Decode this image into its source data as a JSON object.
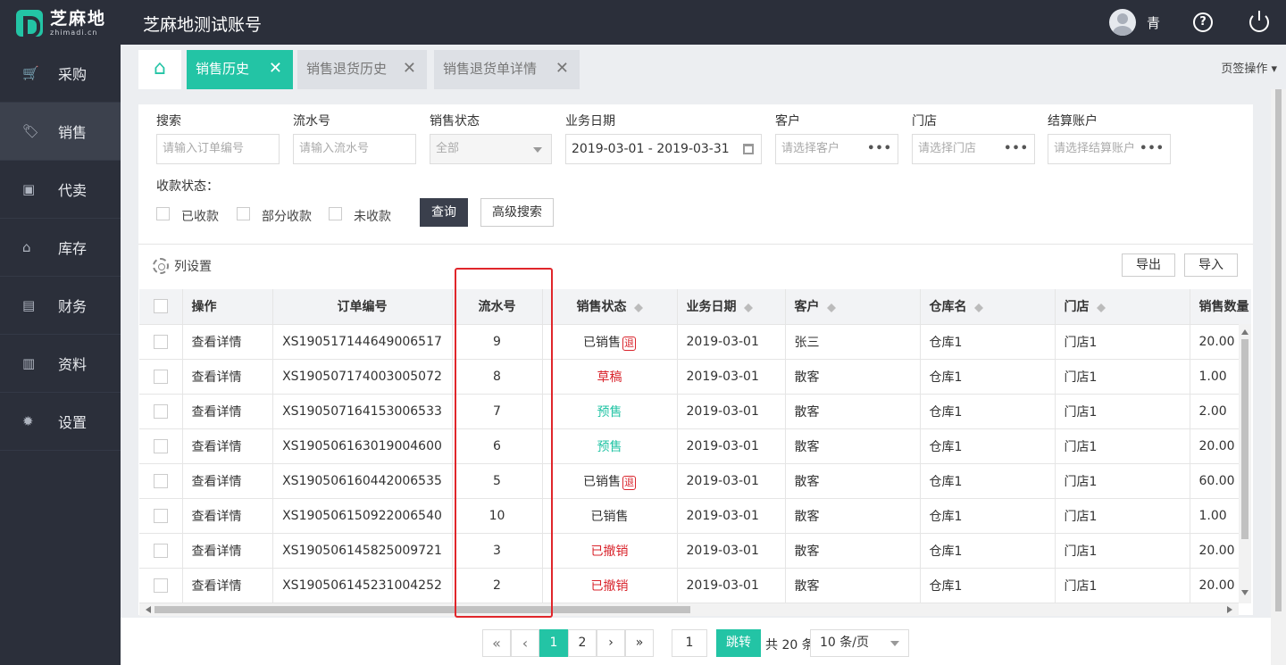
{
  "header": {
    "logo_cn": "芝麻地",
    "logo_en": "zhimadi.cn",
    "title": "芝麻地测试账号",
    "user_name": "青",
    "help_glyph": "?"
  },
  "sidebar": {
    "items": [
      {
        "label": "采购",
        "icon": "🛒"
      },
      {
        "label": "销售",
        "icon": "🏷"
      },
      {
        "label": "代卖",
        "icon": "▣"
      },
      {
        "label": "库存",
        "icon": "⌂"
      },
      {
        "label": "财务",
        "icon": "▤"
      },
      {
        "label": "资料",
        "icon": "▥"
      },
      {
        "label": "设置",
        "icon": "✹"
      }
    ]
  },
  "tabs": {
    "home_icon": "⌂",
    "items": [
      {
        "label": "销售历史"
      },
      {
        "label": "销售退货历史"
      },
      {
        "label": "销售退货单详情"
      }
    ],
    "close_glyph": "✕",
    "ops_label": "页签操作 ▾"
  },
  "filters": {
    "search_label": "搜索",
    "search_placeholder": "请输入订单编号",
    "serial_label": "流水号",
    "serial_placeholder": "请输入流水号",
    "status_label": "销售状态",
    "status_value": "全部",
    "date_label": "业务日期",
    "date_value": "2019-03-01 - 2019-03-31",
    "customer_label": "客户",
    "customer_placeholder": "请选择客户",
    "store_label": "门店",
    "store_placeholder": "请选择门店",
    "account_label": "结算账户",
    "account_placeholder": "请选择结算账户",
    "dots": "•••",
    "payment_label": "收款状态：",
    "payment_options": [
      "已收款",
      "部分收款",
      "未收款"
    ],
    "query_button": "查询",
    "advanced_button": "高级搜索"
  },
  "toolbar": {
    "column_settings": "列设置",
    "export_button": "导出",
    "import_button": "导入"
  },
  "table": {
    "headers": {
      "action": "操作",
      "order_no": "订单编号",
      "serial": "流水号",
      "status": "销售状态",
      "date": "业务日期",
      "customer": "客户",
      "warehouse": "仓库名",
      "store": "门店",
      "quantity": "销售数量"
    },
    "action_label": "查看详情",
    "rows": [
      {
        "order_no": "XS190517144649006517",
        "serial": "9",
        "status": "已销售",
        "returned": "退",
        "date": "2019-03-01",
        "customer": "张三",
        "warehouse": "仓库1",
        "store": "门店1",
        "quantity": "20.00"
      },
      {
        "order_no": "XS190507174003005072",
        "serial": "8",
        "status": "草稿",
        "returned": "",
        "date": "2019-03-01",
        "customer": "散客",
        "warehouse": "仓库1",
        "store": "门店1",
        "quantity": "1.00"
      },
      {
        "order_no": "XS190507164153006533",
        "serial": "7",
        "status": "预售",
        "returned": "",
        "date": "2019-03-01",
        "customer": "散客",
        "warehouse": "仓库1",
        "store": "门店1",
        "quantity": "2.00"
      },
      {
        "order_no": "XS190506163019004600",
        "serial": "6",
        "status": "预售",
        "returned": "",
        "date": "2019-03-01",
        "customer": "散客",
        "warehouse": "仓库1",
        "store": "门店1",
        "quantity": "20.00"
      },
      {
        "order_no": "XS190506160442006535",
        "serial": "5",
        "status": "已销售",
        "returned": "退",
        "date": "2019-03-01",
        "customer": "散客",
        "warehouse": "仓库1",
        "store": "门店1",
        "quantity": "60.00"
      },
      {
        "order_no": "XS190506150922006540",
        "serial": "10",
        "status": "已销售",
        "returned": "",
        "date": "2019-03-01",
        "customer": "散客",
        "warehouse": "仓库1",
        "store": "门店1",
        "quantity": "1.00"
      },
      {
        "order_no": "XS190506145825009721",
        "serial": "3",
        "status": "已撤销",
        "returned": "",
        "date": "2019-03-01",
        "customer": "散客",
        "warehouse": "仓库1",
        "store": "门店1",
        "quantity": "20.00"
      },
      {
        "order_no": "XS190506145231004252",
        "serial": "2",
        "status": "已撤销",
        "returned": "",
        "date": "2019-03-01",
        "customer": "散客",
        "warehouse": "仓库1",
        "store": "门店1",
        "quantity": "20.00"
      }
    ]
  },
  "pagination": {
    "first": "«",
    "prev": "‹",
    "pages": [
      "1",
      "2"
    ],
    "next": "›",
    "last": "»",
    "jump_value": "1",
    "jump_button": "跳转",
    "total": "共 20 条",
    "page_size": "10 条/页"
  },
  "colors": {
    "accent": "#23c4a5",
    "sidebar": "#2b2f3a",
    "danger": "#d9242c"
  }
}
